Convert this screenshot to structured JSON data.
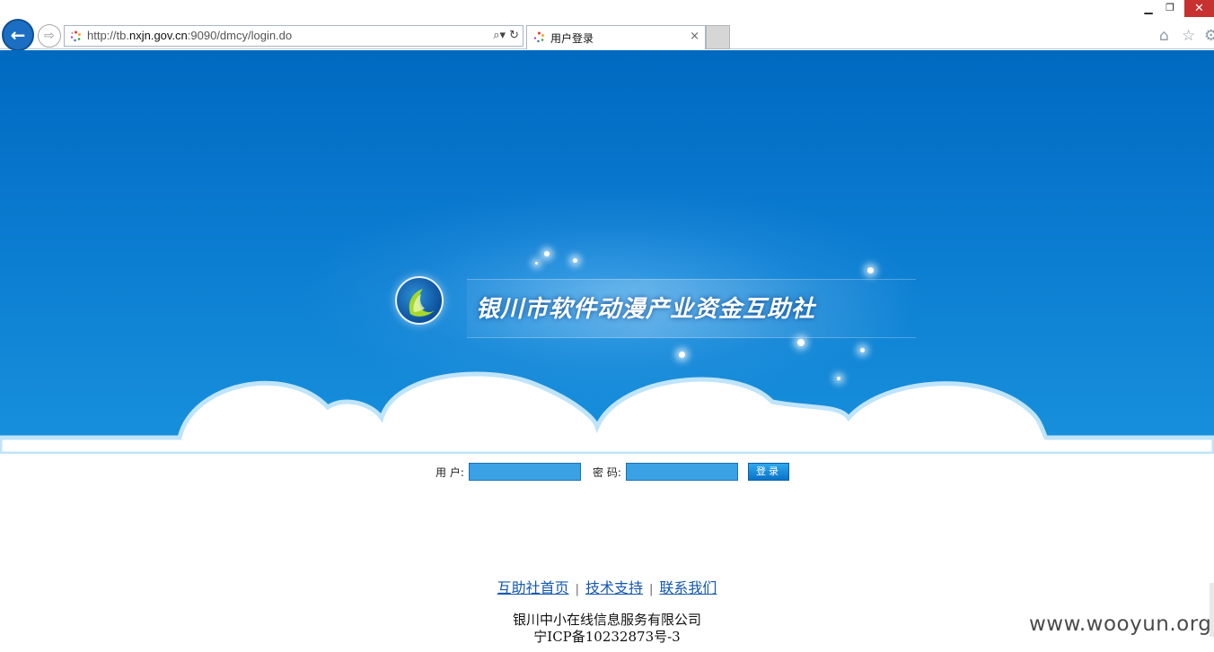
{
  "browser": {
    "url_prefix": "http://tb.",
    "url_domain": "nxjn.gov.cn",
    "url_suffix": ":9090/dmcy/login.do",
    "tab_title": "用户登录",
    "search_glyph": "⌕▾",
    "refresh_glyph": "↻",
    "tab_close_glyph": "×",
    "min_glyph": "▁",
    "max_glyph": "❐",
    "close_glyph": "✕",
    "home_glyph": "⌂",
    "star_glyph": "☆",
    "gear_glyph": "⚙",
    "back_glyph": "←",
    "forward_glyph": "⇨"
  },
  "banner": {
    "site_title": "银川市软件动漫产业资金互助社"
  },
  "login": {
    "user_label": "用 户:",
    "password_label": "密 码:",
    "submit_label": "登录"
  },
  "footer": {
    "link_home": "互助社首页",
    "link_support": "技术支持",
    "link_contact": "联系我们",
    "separator": "|",
    "company": "银川中小在线信息服务有限公司",
    "icp": "宁ICP备10232873号-3"
  },
  "watermark": "www.wooyun.org",
  "colors": {
    "accent": "#1b6ec2",
    "banner_top": "#0069c0",
    "banner_bottom": "#1891dc",
    "input_fill": "#3aa2e4",
    "link": "#1458b0",
    "close_red": "#c7312f"
  }
}
